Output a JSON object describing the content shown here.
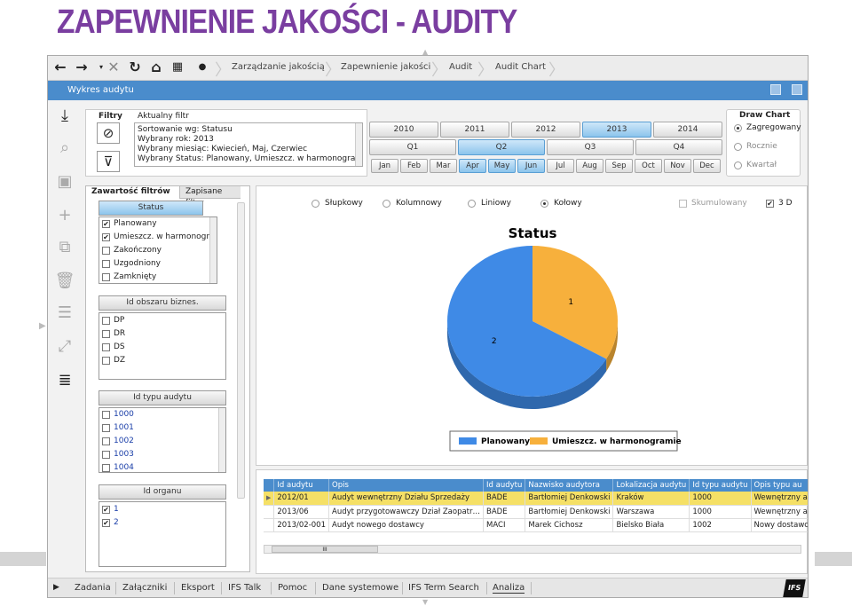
{
  "slide": {
    "title": "ZAPEWNIENIE JAKOŚCI - AUDITY"
  },
  "breadcrumb": [
    "Zarządzanie jakością",
    "Zapewnienie jakości",
    "Audit",
    "Audit Chart"
  ],
  "window": {
    "title": "Wykres audytu"
  },
  "filters": {
    "label": "Filtry",
    "current_label": "Aktualny filtr",
    "current_lines": [
      "Sortowanie wg: Statusu",
      "Wybrany rok: 2013",
      "Wybrany miesiąc: Kwiecień, Maj, Czerwiec",
      "Wybrany Status: Planowany, Umieszcz. w harmonogramie"
    ]
  },
  "years": [
    "2010",
    "2011",
    "2012",
    "2013",
    "2014"
  ],
  "selected_year": "2013",
  "quarters": [
    "Q1",
    "Q2",
    "Q3",
    "Q4"
  ],
  "selected_quarter": "Q2",
  "months": [
    "Jan",
    "Feb",
    "Mar",
    "Apr",
    "May",
    "Jun",
    "Jul",
    "Aug",
    "Sep",
    "Oct",
    "Nov",
    "Dec"
  ],
  "selected_months": [
    "Apr",
    "May",
    "Jun"
  ],
  "draw_chart": {
    "title": "Draw Chart",
    "options": [
      "Zagregowany",
      "Rocznie",
      "Kwartał"
    ],
    "selected": "Zagregowany"
  },
  "tabs": {
    "active": "Zawartość filtrów",
    "other": "Zapisane filtry"
  },
  "status_group": {
    "header": "Status",
    "items": [
      {
        "label": "Planowany",
        "checked": true
      },
      {
        "label": "Umieszcz. w harmonogramie",
        "checked": true
      },
      {
        "label": "Zakończony",
        "checked": false
      },
      {
        "label": "Uzgodniony",
        "checked": false
      },
      {
        "label": "Zamknięty",
        "checked": false
      }
    ]
  },
  "area_group": {
    "header": "Id obszaru biznes.",
    "items": [
      "DP",
      "DR",
      "DS",
      "DZ"
    ]
  },
  "type_group": {
    "header": "Id typu audytu",
    "items": [
      "1000",
      "1001",
      "1002",
      "1003",
      "1004"
    ]
  },
  "organ_group": {
    "header": "Id organu",
    "items": [
      {
        "label": "1",
        "checked": true
      },
      {
        "label": "2",
        "checked": true
      }
    ]
  },
  "chart_types": {
    "options": [
      "Słupkowy",
      "Kolumnowy",
      "Liniowy",
      "Kołowy"
    ],
    "selected": "Kołowy",
    "stacked": "Skumulowany",
    "three_d": "3 D"
  },
  "chart_data": {
    "type": "pie",
    "title": "Status",
    "categories": [
      "Planowany",
      "Umieszcz. w harmonogramie"
    ],
    "values": [
      2,
      1
    ],
    "colors": [
      "#3f8ae6",
      "#f7b03c"
    ],
    "legend_position": "bottom"
  },
  "grid": {
    "columns": [
      "Id audytu",
      "Opis",
      "Id audytu",
      "Nazwisko audytora",
      "Lokalizacja audytu",
      "Id typu audytu",
      "Opis typu au"
    ],
    "rows": [
      [
        "2012/01",
        "Audyt wewnętrzny Działu Sprzedaży",
        "BADE",
        "Bartłomiej Denkowski",
        "Kraków",
        "1000",
        "Wewnętrzny a"
      ],
      [
        "2013/06",
        "Audyt przygotowawczy Dział Zaopatr…",
        "BADE",
        "Bartłomiej Denkowski",
        "Warszawa",
        "1000",
        "Wewnętrzny a"
      ],
      [
        "2013/02-001",
        "Audyt nowego dostawcy",
        "MACI",
        "Marek Cichosz",
        "Bielsko Biała",
        "1002",
        "Nowy dostawc"
      ]
    ],
    "scroll_marker": "III"
  },
  "bottom_tabs": [
    "Zadania",
    "Załączniki",
    "Eksport",
    "IFS Talk",
    "Pomoc",
    "Dane systemowe",
    "IFS Term Search",
    "Analiza"
  ],
  "active_bottom_tab": "Analiza",
  "logo": "IFS"
}
